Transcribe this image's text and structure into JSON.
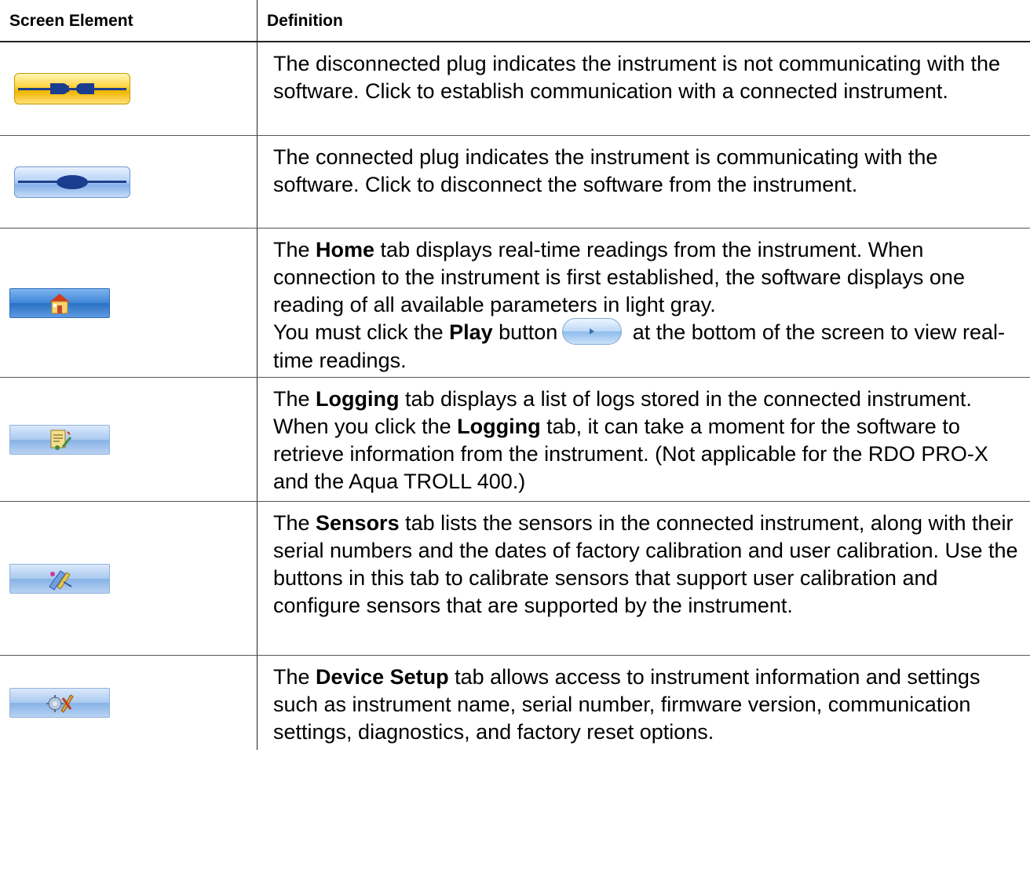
{
  "header": {
    "col1": "Screen Element",
    "col2": "Definition"
  },
  "rows": [
    {
      "icon": "disconnected-plug-icon",
      "text": [
        {
          "t": "The disconnected plug indicates the instrument is not communicating with the software. Click to establish communication with a connected instrument."
        }
      ]
    },
    {
      "icon": "connected-plug-icon",
      "text": [
        {
          "t": "The connected plug indicates the instrument is communicating with the software. Click to disconnect the software from the instrument."
        }
      ]
    },
    {
      "icon": "home-tab-icon",
      "p1": "The ",
      "b1": "Home",
      "p2": " tab displays real-time readings from the instrument. When connection to the instrument is first established, the software displays one reading of all available parameters in light gray.",
      "p3": "You must click the ",
      "b2": "Play",
      "p4": " button",
      "p5": " at the bottom of the screen to view real-time readings."
    },
    {
      "icon": "logging-tab-icon",
      "p1": "The ",
      "b1": "Logging",
      "p2": " tab displays a list of logs stored in the connected instrument. When you click the ",
      "b2": "Logging",
      "p3": " tab, it can take a moment for the software to retrieve information from the instrument. (Not applicable for the RDO PRO-X and the Aqua TROLL 400.)"
    },
    {
      "icon": "sensors-tab-icon",
      "p1": "The ",
      "b1": "Sensors",
      "p2": " tab lists the sensors in the connected instrument, along with their serial numbers and the dates of factory calibration and user calibration. Use the buttons in this tab to calibrate sensors that support user calibration and configure sensors that are supported by the instrument."
    },
    {
      "icon": "device-setup-tab-icon",
      "p1": "The ",
      "b1": "Device Setup",
      "p2": " tab allows access to instrument information and settings such as instrument name, serial number, firmware version, communication settings, diagnostics, and factory reset options."
    }
  ]
}
